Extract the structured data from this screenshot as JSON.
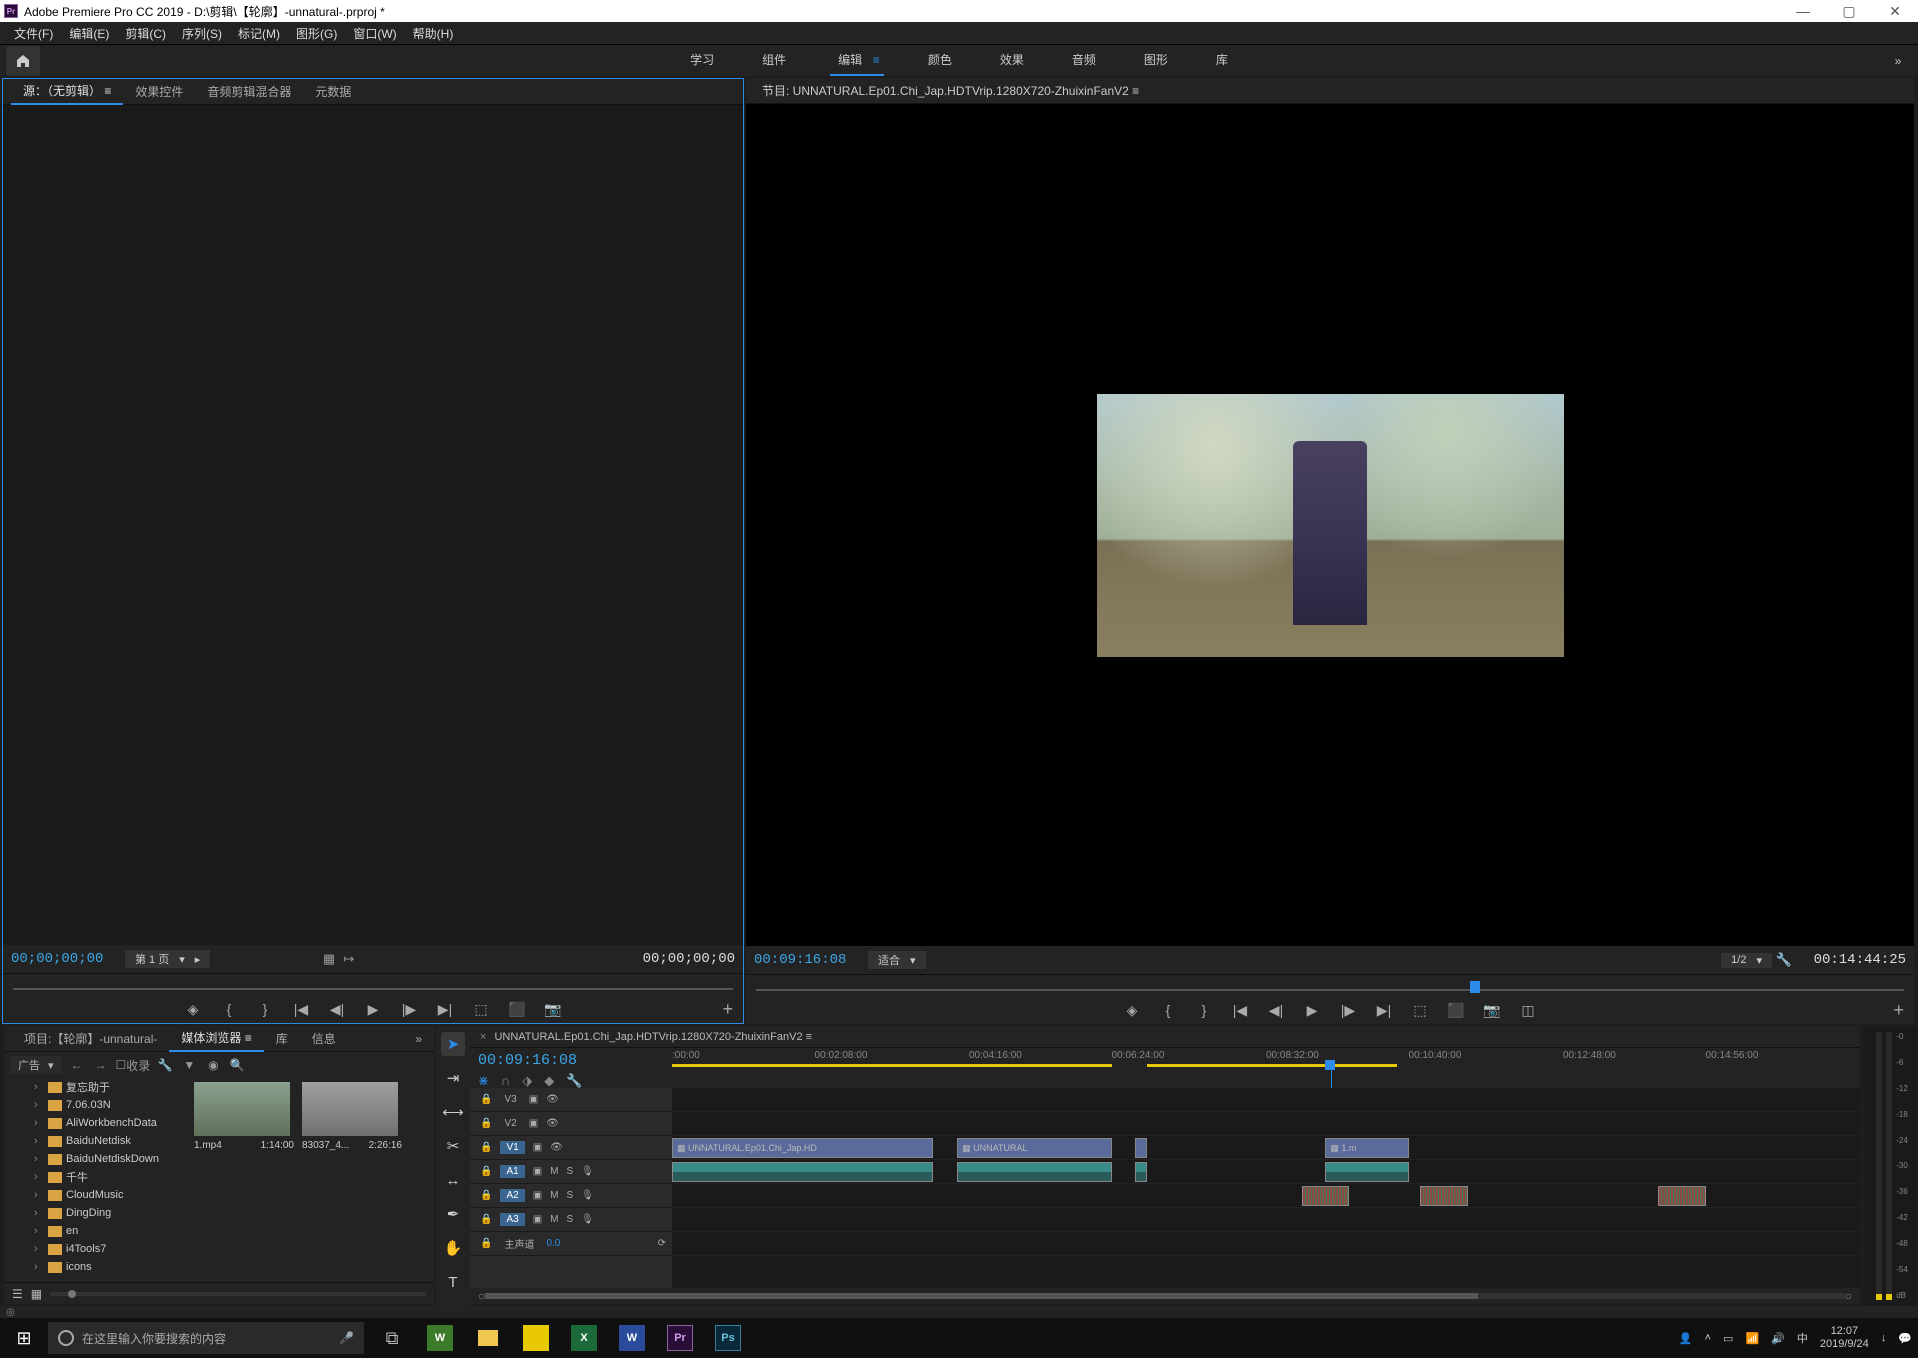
{
  "titleBar": {
    "appIcon": "Pr",
    "title": "Adobe Premiere Pro CC 2019 - D:\\剪辑\\【轮廓】-unnatural-.prproj *"
  },
  "menuBar": [
    "文件(F)",
    "编辑(E)",
    "剪辑(C)",
    "序列(S)",
    "标记(M)",
    "图形(G)",
    "窗口(W)",
    "帮助(H)"
  ],
  "workspaces": {
    "items": [
      "学习",
      "组件",
      "编辑",
      "颜色",
      "效果",
      "音频",
      "图形",
      "库"
    ],
    "activeIndex": 2,
    "more": "»"
  },
  "sourcePanel": {
    "tabs": [
      "源：（无剪辑）",
      "效果控件",
      "音频剪辑混合器",
      "元数据"
    ],
    "activeIndex": 0,
    "tcIn": "00;00;00;00",
    "page": "第 1 页",
    "tcOut": "00;00;00;00"
  },
  "programPanel": {
    "title": "节目: UNNATURAL.Ep01.Chi_Jap.HDTVrip.1280X720-ZhuixinFanV2",
    "tcCurrent": "00:09:16:08",
    "fit": "适合",
    "zoom": "1/2",
    "tcDuration": "00:14:44:25"
  },
  "projectPanel": {
    "tabs": [
      "项目:【轮廓】-unnatural-",
      "媒体浏览器",
      "库",
      "信息"
    ],
    "activeIndex": 1,
    "more": "»",
    "filterLabel": "广告",
    "ingest": "收录",
    "tree": [
      "复忘助于",
      "7.06.03N",
      "AliWorkbenchData",
      "BaiduNetdisk",
      "BaiduNetdiskDown",
      "千牛",
      "CloudMusic",
      "DingDing",
      "en",
      "i4Tools7",
      "icons"
    ],
    "thumbs": [
      {
        "name": "1.mp4",
        "dur": "1:14:00"
      },
      {
        "name": "83037_4...",
        "dur": "2:26:16"
      }
    ]
  },
  "timeline": {
    "seqName": "UNNATURAL.Ep01.Chi_Jap.HDTVrip.1280X720-ZhuixinFanV2",
    "tc": "00:09:16:08",
    "ruler": [
      ":00:00",
      "00:02:08:00",
      "00:04:16:00",
      "00:06:24:00",
      "00:08:32:00",
      "00:10:40:00",
      "00:12:48:00",
      "00:14:56:00"
    ],
    "tracks": {
      "v3": "V3",
      "v2": "V2",
      "v1": "V1",
      "a1": "A1",
      "a2": "A2",
      "a3": "A3",
      "master": "主声道",
      "masterVal": "0.0"
    },
    "clips": {
      "v1_1": "UNNATURAL.Ep01.Chi_Jap.HD",
      "v1_2": "UNNATURAL",
      "v1_3": "1.m"
    }
  },
  "taskbar": {
    "search": "在这里输入你要搜索的内容",
    "time": "12:07",
    "date": "2019/9/24",
    "ime": "中"
  }
}
